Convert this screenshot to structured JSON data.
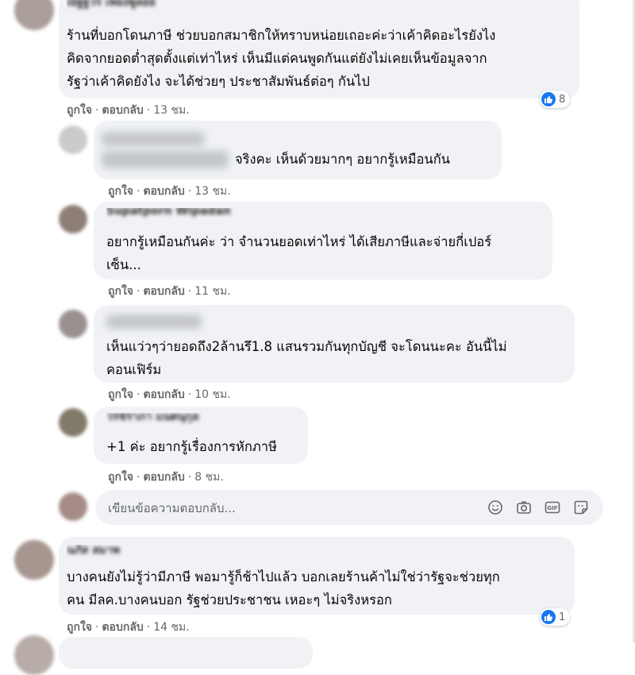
{
  "comments": [
    {
      "lines": [
        "ร้านที่บอกโดนภาษี ช่วยบอกสมาชิกให้ทราบหน่อยเถอะค่ะว่าเค้าคิดอะไรยังไง",
        "คิดจากยอดต่ำสุดตั้งแต่เท่าไหร่ เห็นมีแต่คนพูดกันแต่ยังไม่เคยเห็นข้อมูลจาก",
        "รัฐว่าเค้าคิดยังไง จะได้ช่วยๆ ประชาสัมพันธ์ต่อๆ กันไป"
      ],
      "like_label": "ถูกใจ",
      "reply_label": "ตอบกลับ",
      "time": "13 ชม.",
      "reaction_count": "8"
    },
    {
      "lines": [
        "จริงคะ เห็นด้วยมากๆ อยากรู้เหมือนกัน"
      ],
      "like_label": "ถูกใจ",
      "reply_label": "ตอบกลับ",
      "time": "13 ชม."
    },
    {
      "lines": [
        "อยากรู้เหมือนกันค่ะ ว่า จำนวนยอดเท่าไหร่ ได้เสียภาษีและจ่ายกี่เปอร์",
        "เซ็น..."
      ],
      "like_label": "ถูกใจ",
      "reply_label": "ตอบกลับ",
      "time": "11 ชม."
    },
    {
      "lines": [
        "เห็นแว่วๆว่ายอดถึง2ล้านรึ1.8 แสนรวมกันทุกบัญชี จะโดนนะคะ อันนี้ไม่",
        "คอนเฟิร์ม"
      ],
      "like_label": "ถูกใจ",
      "reply_label": "ตอบกลับ",
      "time": "10 ชม."
    },
    {
      "lines": [
        "+1 ค่ะ อยากรู้เรื่องการหักภาษี"
      ],
      "like_label": "ถูกใจ",
      "reply_label": "ตอบกลับ",
      "time": "8 ชม."
    },
    {
      "lines": [
        "บางคนยังไม่รู้ว่ามีภาษี พอมารู้ก็ช้าไปแล้ว บอกเลยร้านค้าไม่ใช่ว่ารัฐจะช่วยทุก",
        "คน มีลค.บางคนบอก รัฐช่วยประชาชน เหอะๆ ไม่จริงหรอก"
      ],
      "like_label": "ถูกใจ",
      "reply_label": "ตอบกลับ",
      "time": "14 ชม.",
      "reaction_count": "1"
    }
  ],
  "reply_box": {
    "placeholder": "เขียนข้อความตอบกลับ...",
    "icons": [
      "emoji-icon",
      "camera-icon",
      "gif-icon",
      "sticker-icon"
    ]
  },
  "colors": {
    "bubble": "#f0f2f5",
    "meta_text": "#65676b",
    "like_blue": "#1877f2"
  }
}
